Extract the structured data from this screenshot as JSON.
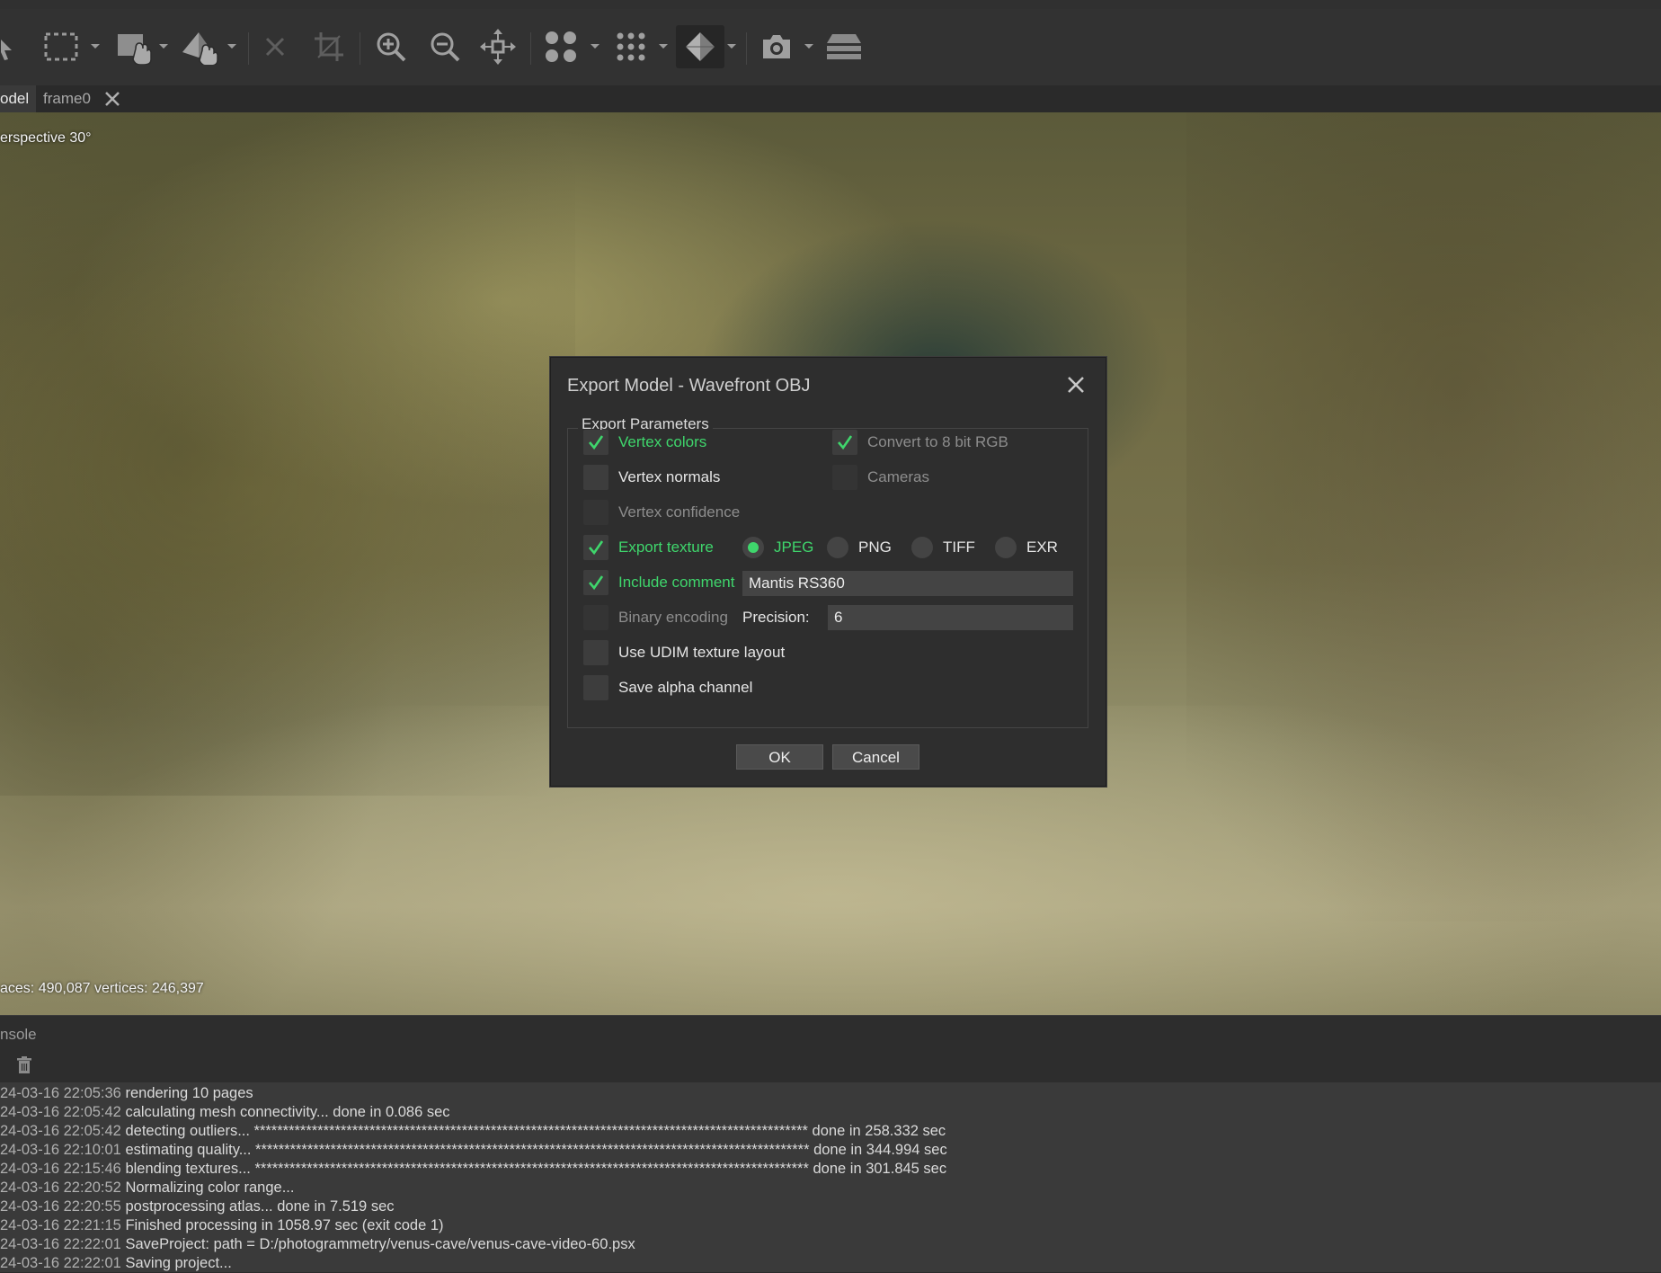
{
  "toolbar": {
    "icons": [
      "select-arrow-icon",
      "rectangle-selection-icon",
      "brush-selection-icon",
      "navigation-mode-icon",
      "delete-icon",
      "crop-icon",
      "zoom-in-icon",
      "zoom-out-icon",
      "reset-view-icon",
      "point-cloud-icon",
      "dense-cloud-icon",
      "model-shaded-icon",
      "camera-capture-icon",
      "layers-icon"
    ]
  },
  "tabs": [
    {
      "label": "odel"
    },
    {
      "label": "frame0"
    }
  ],
  "viewport": {
    "projection_label": "erspective 30°",
    "stats_label": "aces: 490,087 vertices: 246,397"
  },
  "dialog": {
    "title": "Export Model - Wavefront OBJ",
    "group_title": "Export Parameters",
    "vertex_colors": {
      "label": "Vertex colors",
      "checked": true
    },
    "convert_8bit": {
      "label": "Convert to 8 bit RGB",
      "checked": true
    },
    "vertex_normals": {
      "label": "Vertex normals",
      "checked": false
    },
    "cameras": {
      "label": "Cameras",
      "checked": false
    },
    "vertex_confidence": {
      "label": "Vertex confidence",
      "checked": false
    },
    "export_texture": {
      "label": "Export texture",
      "checked": true
    },
    "formats": [
      {
        "label": "JPEG",
        "selected": true
      },
      {
        "label": "PNG",
        "selected": false
      },
      {
        "label": "TIFF",
        "selected": false
      },
      {
        "label": "EXR",
        "selected": false
      }
    ],
    "include_comment": {
      "label": "Include comment",
      "checked": true,
      "value": "Mantis RS360"
    },
    "binary_encoding": {
      "label": "Binary encoding",
      "checked": false
    },
    "precision": {
      "label": "Precision:",
      "value": "6"
    },
    "udim": {
      "label": "Use UDIM texture layout",
      "checked": false
    },
    "save_alpha": {
      "label": "Save alpha channel",
      "checked": false
    },
    "ok_label": "OK",
    "cancel_label": "Cancel"
  },
  "console": {
    "title": "nsole",
    "lines": [
      {
        "ts": "24-03-16 22:05:36",
        "msg": "rendering 10 pages"
      },
      {
        "ts": "24-03-16 22:05:42",
        "msg": "calculating mesh connectivity... done in 0.086 sec"
      },
      {
        "ts": "24-03-16 22:05:42",
        "msg": "detecting outliers... ************************************************************************************************ done in 258.332 sec"
      },
      {
        "ts": "24-03-16 22:10:01",
        "msg": "estimating quality... ************************************************************************************************ done in 344.994 sec"
      },
      {
        "ts": "24-03-16 22:15:46",
        "msg": "blending textures... ************************************************************************************************ done in 301.845 sec"
      },
      {
        "ts": "24-03-16 22:20:52",
        "msg": "Normalizing color range..."
      },
      {
        "ts": "24-03-16 22:20:55",
        "msg": "postprocessing atlas... done in 7.519 sec"
      },
      {
        "ts": "24-03-16 22:21:15",
        "msg": "Finished processing in 1058.97 sec (exit code 1)"
      },
      {
        "ts": "24-03-16 22:22:01",
        "msg": "SaveProject: path = D:/photogrammetry/venus-cave/venus-cave-video-60.psx"
      },
      {
        "ts": "24-03-16 22:22:01",
        "msg": "Saving project..."
      }
    ]
  },
  "colors": {
    "accent_green": "#3fd66c",
    "dialog_bg": "#2e2e2e",
    "console_bg": "#3a3a3a"
  }
}
